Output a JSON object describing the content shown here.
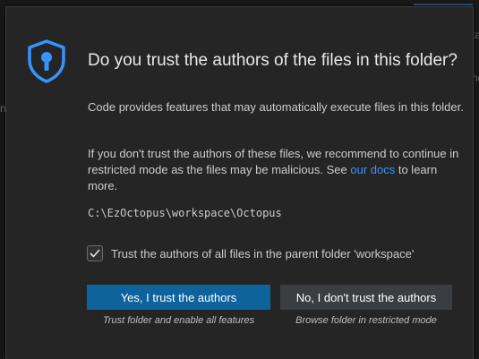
{
  "colors": {
    "accent": "#3794ff",
    "primary_button": "#0e639c",
    "secondary_button": "#3a3d41",
    "dialog_bg": "#252526"
  },
  "background": {
    "edge_texts": [
      "ta",
      "ng",
      "n"
    ]
  },
  "dialog": {
    "icon": "shield-keyhole-icon",
    "title": "Do you trust the authors of the files in this folder?",
    "paragraph1": "Code provides features that may automatically execute files in this folder.",
    "paragraph2_before": "If you don't trust the authors of these files, we recommend to continue in restricted mode as the files may be malicious. See ",
    "paragraph2_link": "our docs",
    "paragraph2_after": " to learn more.",
    "folder_path": "C:\\EzOctopus\\workspace\\Octopus",
    "checkbox": {
      "checked": true,
      "label": "Trust the authors of all files in the parent folder 'workspace'"
    },
    "buttons": {
      "trust_label": "Yes, I trust the authors",
      "trust_hint": "Trust folder and enable all features",
      "distrust_label": "No, I don't trust the authors",
      "distrust_hint": "Browse folder in restricted mode"
    }
  }
}
